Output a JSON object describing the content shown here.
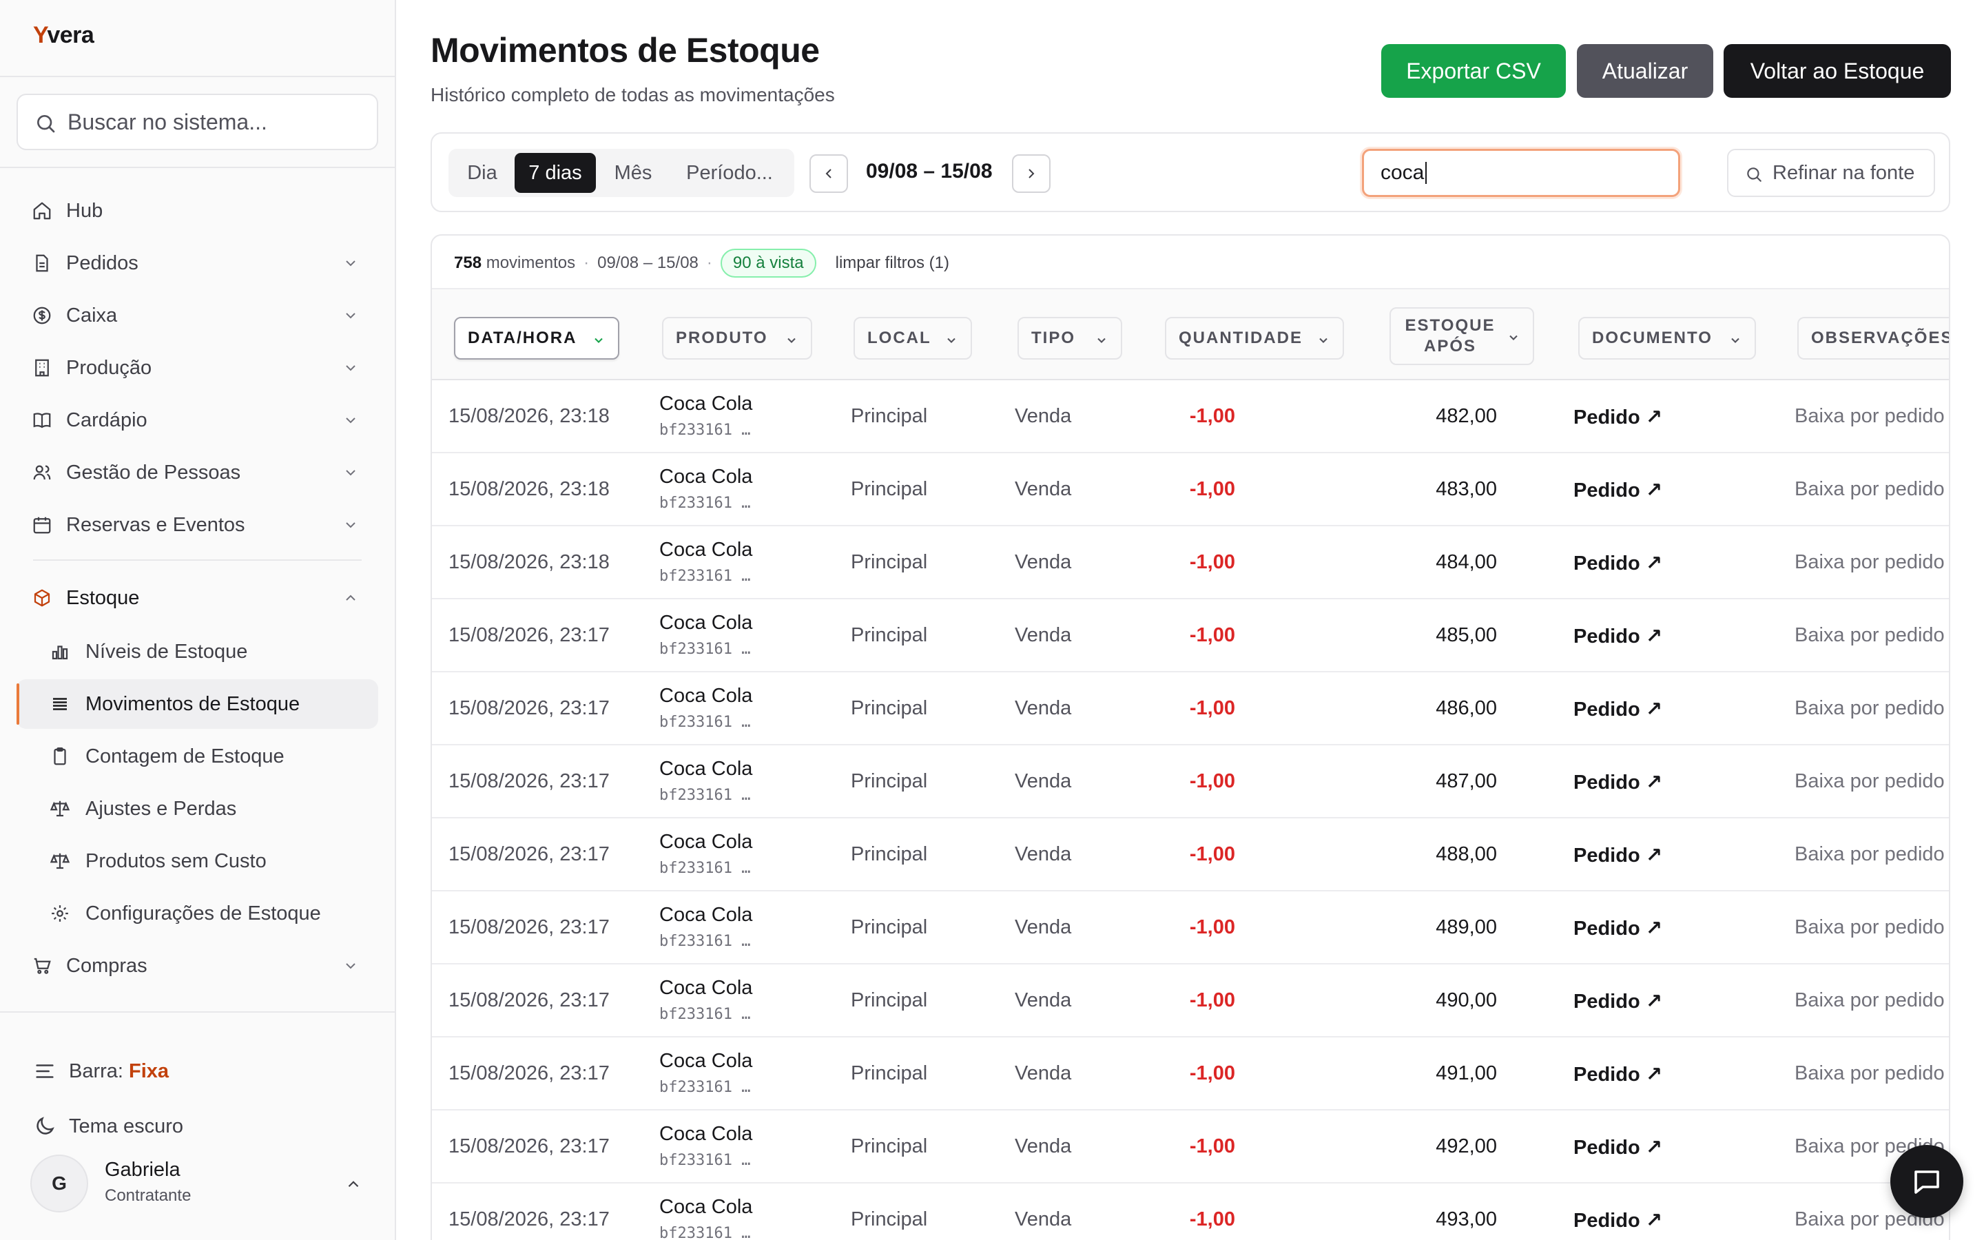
{
  "brand": {
    "first": "Y",
    "rest": "vera"
  },
  "sidebar": {
    "search_placeholder": "Buscar no sistema...",
    "items": [
      {
        "label": "Hub",
        "icon": "home-icon",
        "chevron": false
      },
      {
        "label": "Pedidos",
        "icon": "document-icon",
        "chevron": true
      },
      {
        "label": "Caixa",
        "icon": "dollar-circle-icon",
        "chevron": true
      },
      {
        "label": "Produção",
        "icon": "building-icon",
        "chevron": true
      },
      {
        "label": "Cardápio",
        "icon": "book-icon",
        "chevron": true
      },
      {
        "label": "Gestão de Pessoas",
        "icon": "users-icon",
        "chevron": true
      },
      {
        "label": "Reservas e Eventos",
        "icon": "calendar-icon",
        "chevron": true
      }
    ],
    "estoque": {
      "label": "Estoque",
      "icon": "box-icon",
      "children": [
        {
          "label": "Níveis de Estoque",
          "icon": "bar-chart-icon"
        },
        {
          "label": "Movimentos de Estoque",
          "icon": "list-icon",
          "active": true
        },
        {
          "label": "Contagem de Estoque",
          "icon": "clipboard-icon"
        },
        {
          "label": "Ajustes e Perdas",
          "icon": "scale-icon"
        },
        {
          "label": "Produtos sem Custo",
          "icon": "scale-icon"
        },
        {
          "label": "Configurações de Estoque",
          "icon": "gear-icon"
        }
      ]
    },
    "compras": {
      "label": "Compras",
      "icon": "cart-icon"
    },
    "bar_label": "Barra:",
    "bar_value": "Fixa",
    "theme_label": "Tema escuro",
    "user": {
      "initial": "G",
      "name": "Gabriela",
      "role": "Contratante"
    }
  },
  "header": {
    "title": "Movimentos de Estoque",
    "subtitle": "Histórico completo de todas as movimentações",
    "export_label": "Exportar CSV",
    "refresh_label": "Atualizar",
    "back_label": "Voltar ao Estoque"
  },
  "filters": {
    "periods": [
      "Dia",
      "7 dias",
      "Mês",
      "Período..."
    ],
    "active_period": "7 dias",
    "range": "09/08 – 15/08",
    "search_value": "coca",
    "refine_label": "Refinar na fonte"
  },
  "summary": {
    "count": "758",
    "count_label": "movimentos",
    "range": "09/08 – 15/08",
    "badge": "90 à vista",
    "clear": "limpar filtros (1)"
  },
  "columns": {
    "date": "DATA/HORA",
    "product": "PRODUTO",
    "local": "LOCAL",
    "type": "TIPO",
    "qty": "QUANTIDADE",
    "after_1": "ESTOQUE",
    "after_2": "APÓS",
    "doc": "DOCUMENTO",
    "obs": "OBSERVAÇÕES"
  },
  "rows": [
    {
      "date": "15/08/2026, 23:18",
      "product": "Coca Cola",
      "code": "bf233161 …",
      "local": "Principal",
      "type": "Venda",
      "qty": "-1,00",
      "after": "482,00",
      "doc": "Pedido ↗",
      "obs": "Baixa por pedido"
    },
    {
      "date": "15/08/2026, 23:18",
      "product": "Coca Cola",
      "code": "bf233161 …",
      "local": "Principal",
      "type": "Venda",
      "qty": "-1,00",
      "after": "483,00",
      "doc": "Pedido ↗",
      "obs": "Baixa por pedido"
    },
    {
      "date": "15/08/2026, 23:18",
      "product": "Coca Cola",
      "code": "bf233161 …",
      "local": "Principal",
      "type": "Venda",
      "qty": "-1,00",
      "after": "484,00",
      "doc": "Pedido ↗",
      "obs": "Baixa por pedido"
    },
    {
      "date": "15/08/2026, 23:17",
      "product": "Coca Cola",
      "code": "bf233161 …",
      "local": "Principal",
      "type": "Venda",
      "qty": "-1,00",
      "after": "485,00",
      "doc": "Pedido ↗",
      "obs": "Baixa por pedido"
    },
    {
      "date": "15/08/2026, 23:17",
      "product": "Coca Cola",
      "code": "bf233161 …",
      "local": "Principal",
      "type": "Venda",
      "qty": "-1,00",
      "after": "486,00",
      "doc": "Pedido ↗",
      "obs": "Baixa por pedido"
    },
    {
      "date": "15/08/2026, 23:17",
      "product": "Coca Cola",
      "code": "bf233161 …",
      "local": "Principal",
      "type": "Venda",
      "qty": "-1,00",
      "after": "487,00",
      "doc": "Pedido ↗",
      "obs": "Baixa por pedido"
    },
    {
      "date": "15/08/2026, 23:17",
      "product": "Coca Cola",
      "code": "bf233161 …",
      "local": "Principal",
      "type": "Venda",
      "qty": "-1,00",
      "after": "488,00",
      "doc": "Pedido ↗",
      "obs": "Baixa por pedido"
    },
    {
      "date": "15/08/2026, 23:17",
      "product": "Coca Cola",
      "code": "bf233161 …",
      "local": "Principal",
      "type": "Venda",
      "qty": "-1,00",
      "after": "489,00",
      "doc": "Pedido ↗",
      "obs": "Baixa por pedido"
    },
    {
      "date": "15/08/2026, 23:17",
      "product": "Coca Cola",
      "code": "bf233161 …",
      "local": "Principal",
      "type": "Venda",
      "qty": "-1,00",
      "after": "490,00",
      "doc": "Pedido ↗",
      "obs": "Baixa por pedido"
    },
    {
      "date": "15/08/2026, 23:17",
      "product": "Coca Cola",
      "code": "bf233161 …",
      "local": "Principal",
      "type": "Venda",
      "qty": "-1,00",
      "after": "491,00",
      "doc": "Pedido ↗",
      "obs": "Baixa por pedido"
    },
    {
      "date": "15/08/2026, 23:17",
      "product": "Coca Cola",
      "code": "bf233161 …",
      "local": "Principal",
      "type": "Venda",
      "qty": "-1,00",
      "after": "492,00",
      "doc": "Pedido ↗",
      "obs": "Baixa por pedido"
    },
    {
      "date": "15/08/2026, 23:17",
      "product": "Coca Cola",
      "code": "bf233161 …",
      "local": "Principal",
      "type": "Venda",
      "qty": "-1,00",
      "after": "493,00",
      "doc": "Pedido ↗",
      "obs": "Baixa por pedido"
    }
  ],
  "colors": {
    "accent": "#c2410c",
    "export": "#16a34a",
    "negative": "#dc2626",
    "badge_green": "#15803d"
  }
}
